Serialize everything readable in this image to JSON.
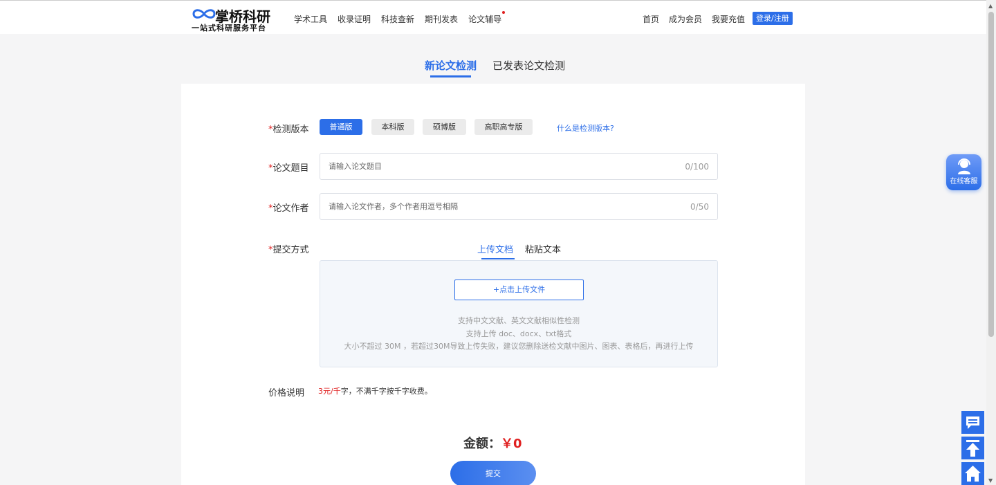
{
  "header": {
    "logo_title": "掌桥科研",
    "logo_subtitle": "一站式科研服务平台",
    "nav_left": [
      "学术工具",
      "收录证明",
      "科技查新",
      "期刊发表",
      "论文辅导"
    ],
    "nav_right": [
      "首页",
      "成为会员",
      "我要充值"
    ],
    "login_label": "登录/注册"
  },
  "tabs": {
    "new_paper": "新论文检测",
    "published_paper": "已发表论文检测"
  },
  "form": {
    "version_label": "检测版本",
    "required_mark": "*",
    "versions": [
      "普通版",
      "本科版",
      "硕博版",
      "高职高专版"
    ],
    "selected_version": "普通版",
    "version_help": "什么是检测版本?",
    "title_label": "论文题目",
    "title_placeholder": "请输入论文题目",
    "title_count": "0/100",
    "author_label": "论文作者",
    "author_placeholder": "请输入论文作者，多个作者用逗号相隔",
    "author_count": "0/50",
    "submit_method_label": "提交方式",
    "submit_tabs": [
      "上传文档",
      "粘贴文本"
    ],
    "upload_button": "+点击上传文件",
    "upload_tips": [
      "支持中文文献、英文文献相似性检测",
      "支持上传 doc、docx、txt格式",
      "大小不超过 30M ，若超过30M导致上传失败，建议您删除送检文献中图片、图表、表格后，再进行上传"
    ],
    "price_label": "价格说明",
    "price_highlight": "3元/千",
    "price_rest": "字，不满千字按千字收费。",
    "amount_label": "金额：",
    "amount_value": "￥0",
    "submit_label": "提交"
  },
  "float": {
    "service_label": "在线客服"
  },
  "colors": {
    "accent": "#2c6ee8",
    "price_red": "#e02020"
  }
}
